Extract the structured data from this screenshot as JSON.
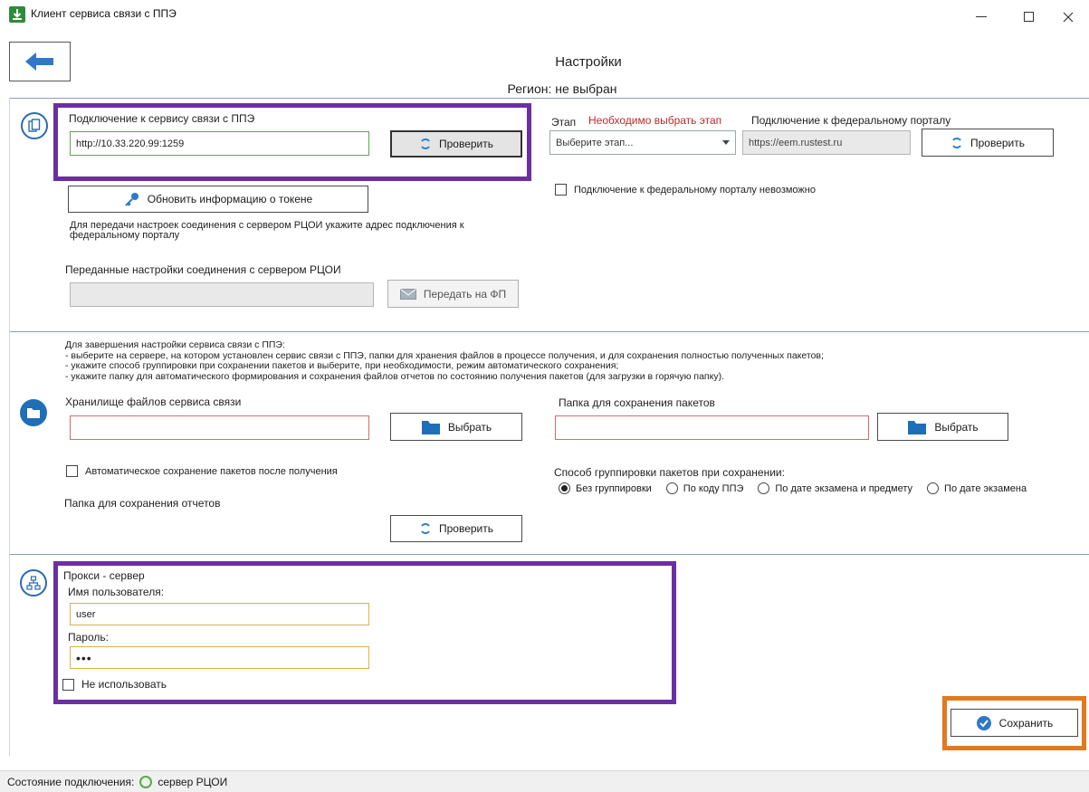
{
  "window": {
    "title": "Клиент сервиса связи с ППЭ"
  },
  "header": {
    "page_title": "Настройки",
    "region": "Регион: не выбран"
  },
  "connection": {
    "label": "Подключение к сервису связи с ППЭ",
    "url": "http://10.33.220.99:1259",
    "check_label": "Проверить",
    "token_label": "Обновить информацию о токене",
    "transfer_hint": "Для передачи настроек соединения с сервером РЦОИ укажите адрес подключения к федеральному порталу",
    "transferred_label": "Переданные настройки соединения с сервером РЦОИ",
    "transferred_value": "",
    "send_label": "Передать на ФП"
  },
  "stage": {
    "label": "Этап",
    "warning": "Необходимо выбрать этап",
    "select_placeholder": "Выберите этап...",
    "federal_label": "Подключение к федеральному порталу",
    "federal_url": "https://eem.rustest.ru",
    "check_label": "Проверить",
    "federal_unavailable_label": "Подключение к федеральному порталу невозможно"
  },
  "storage": {
    "instructions": [
      "Для завершения настройки сервиса связи с ППЭ:",
      "- выберите на сервере, на котором установлен сервис связи с ППЭ, папки для хранения файлов в процессе получения, и для сохранения полностью полученных пакетов;",
      "- укажите способ группировки при сохранении пакетов и выберите, при необходимости, режим автоматического сохранения;",
      "- укажите папку для автоматического формирования и сохранения файлов отчетов по состоянию получения пакетов (для загрузки в горячую папку)."
    ],
    "storage_label": "Хранилище файлов сервиса связи",
    "storage_value": "",
    "choose_label": "Выбрать",
    "packages_label": "Папка для сохранения пакетов",
    "packages_value": "",
    "auto_save_label": "Автоматическое сохранение пакетов после получения",
    "reports_label": "Папка для сохранения отчетов",
    "check_label": "Проверить",
    "grouping_label": "Способ группировки пакетов при сохранении:",
    "grouping_options": [
      "Без группировки",
      "По коду ППЭ",
      "По дате экзамена и предмету",
      "По дате экзамена"
    ],
    "grouping_selected": "Без группировки"
  },
  "proxy": {
    "title": "Прокси - сервер",
    "user_label": "Имя пользователя:",
    "user_value": "user",
    "password_label": "Пароль:",
    "password_value": "•••",
    "not_use_label": "Не использовать"
  },
  "save_label": "Сохранить",
  "status": {
    "label": "Состояние подключения:",
    "server": "сервер РЦОИ"
  },
  "colors": {
    "highlight_purple": "#6b2fa3",
    "highlight_orange": "#e07a1f",
    "accent_blue": "#1f6fb8",
    "warning_red": "#c0282d"
  }
}
